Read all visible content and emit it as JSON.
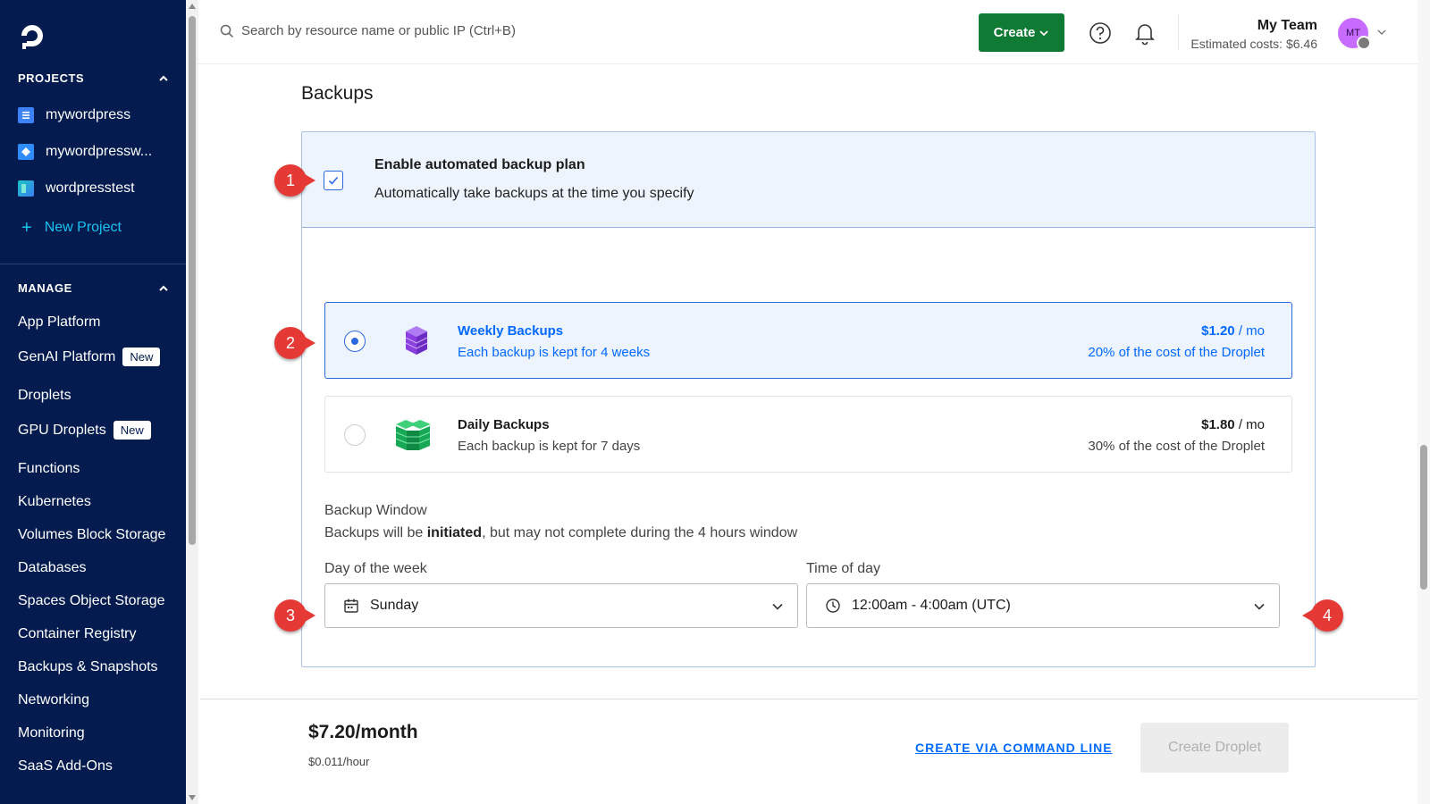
{
  "sidebar": {
    "projects_heading": "PROJECTS",
    "projects": [
      {
        "label": "mywordpress",
        "icon": "list-project-icon"
      },
      {
        "label": "mywordpressw...",
        "icon": "diamond-project-icon"
      },
      {
        "label": "wordpresstest",
        "icon": "gradient-project-icon"
      }
    ],
    "new_project": "New Project",
    "manage_heading": "MANAGE",
    "items": [
      {
        "label": "App Platform"
      },
      {
        "label": "GenAI Platform",
        "badge": "New"
      },
      {
        "label": "Droplets"
      },
      {
        "label": "GPU Droplets",
        "badge": "New"
      },
      {
        "label": "Functions"
      },
      {
        "label": "Kubernetes"
      },
      {
        "label": "Volumes Block Storage"
      },
      {
        "label": "Databases"
      },
      {
        "label": "Spaces Object Storage"
      },
      {
        "label": "Container Registry"
      },
      {
        "label": "Backups & Snapshots"
      },
      {
        "label": "Networking"
      },
      {
        "label": "Monitoring"
      },
      {
        "label": "SaaS Add-Ons"
      }
    ]
  },
  "topbar": {
    "search_placeholder": "Search by resource name or public IP (Ctrl+B)",
    "create_label": "Create",
    "team_name": "My Team",
    "estimated_costs": "Estimated costs: $6.46",
    "avatar_initials": "MT"
  },
  "backups": {
    "section_title": "Backups",
    "enable_title": "Enable automated backup plan",
    "enable_subtitle": "Automatically take backups at the time you specify",
    "enabled": true,
    "options": [
      {
        "title": "Weekly Backups",
        "subtitle": "Each backup is kept for 4 weeks",
        "price": "$1.20",
        "unit": " / mo",
        "fraction": "20% of the cost of the Droplet",
        "selected": true
      },
      {
        "title": "Daily Backups",
        "subtitle": "Each backup is kept for 7 days",
        "price": "$1.80",
        "unit": " / mo",
        "fraction": "30% of the cost of the Droplet",
        "selected": false
      }
    ],
    "window_title": "Backup Window",
    "window_sub_before": "Backups will be ",
    "window_sub_bold": "initiated",
    "window_sub_after": ", but may not complete during the 4 hours window",
    "day_label": "Day of the week",
    "day_value": "Sunday",
    "time_label": "Time of day",
    "time_value": "12:00am - 4:00am (UTC)"
  },
  "annotations": [
    "1",
    "2",
    "3",
    "4"
  ],
  "footer": {
    "price_month": "$7.20/month",
    "price_hour": "$0.011/hour",
    "cli_link": "CREATE VIA COMMAND LINE",
    "create_droplet": "Create Droplet"
  },
  "colors": {
    "sidebar_bg": "#031b4e",
    "accent_blue": "#0069ff",
    "create_green": "#0e7a33",
    "annotation_red": "#e53935"
  }
}
